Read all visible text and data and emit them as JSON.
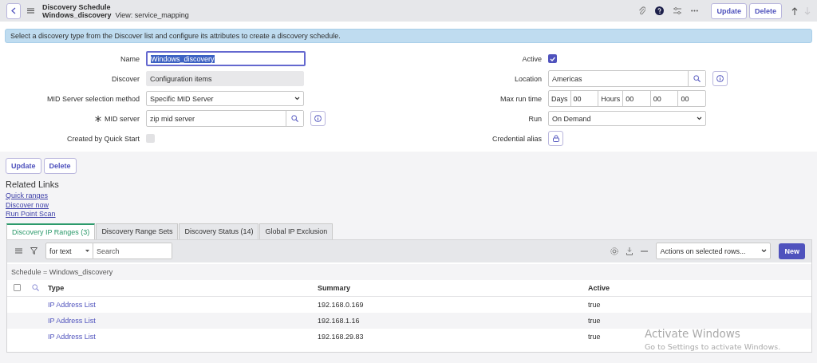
{
  "header": {
    "title": "Discovery Schedule",
    "record": "Windows_discovery",
    "view": "View: service_mapping",
    "buttons": [
      "Update",
      "Delete"
    ],
    "nav": [
      {
        "kind": "up",
        "disabled": false
      },
      {
        "kind": "down",
        "disabled": true
      }
    ]
  },
  "info_message": "Select a discovery type from the Discover list and configure its attributes to create a discovery schedule.",
  "form": {
    "left": [
      {
        "kind": "text",
        "label": "Name",
        "value": "Windows_discovery",
        "focused": true
      },
      {
        "kind": "readonly",
        "label": "Discover",
        "value": "Configuration items"
      },
      {
        "kind": "select",
        "label": "MID Server selection method",
        "value": "Specific MID Server"
      },
      {
        "kind": "reference",
        "label": "MID server",
        "value": "zip mid server",
        "required": true
      },
      {
        "kind": "checkbox",
        "label": "Created by Quick Start",
        "checked": false
      }
    ],
    "right": [
      {
        "kind": "checkbox",
        "label": "Active",
        "checked": true
      },
      {
        "kind": "reference",
        "label": "Location",
        "value": "Americas",
        "required": false
      },
      {
        "kind": "duration",
        "label": "Max run time",
        "parts": [
          {
            "unit": "Days",
            "value": "00"
          },
          {
            "unit": "Hours",
            "value": "00"
          },
          {
            "value": "00"
          },
          {
            "value": "00"
          }
        ]
      },
      {
        "kind": "select",
        "label": "Run",
        "value": "On Demand"
      },
      {
        "kind": "lock",
        "label": "Credential alias"
      }
    ]
  },
  "bottom_buttons": [
    "Update",
    "Delete"
  ],
  "related_links": {
    "title": "Related Links",
    "links": [
      "Quick ranges",
      "Discover now",
      "Run Point Scan"
    ]
  },
  "tabs": [
    {
      "label": "Discovery IP Ranges (3)",
      "selected": true
    },
    {
      "label": "Discovery Range Sets",
      "selected": false
    },
    {
      "label": "Discovery Status (14)",
      "selected": false
    },
    {
      "label": "Global IP Exclusion",
      "selected": false
    }
  ],
  "list": {
    "select_all_checked": false,
    "filter_select": "for text",
    "search_placeholder": "Search",
    "actions_select": "Actions on selected rows...",
    "new_button": "New",
    "breadcrumb": "Schedule = Windows_discovery",
    "columns": [
      "Type",
      "Summary",
      "Active"
    ],
    "rows": [
      {
        "type": "IP Address List",
        "summary": "192.168.0.169",
        "active": "true"
      },
      {
        "type": "IP Address List",
        "summary": "192.168.1.16",
        "active": "true"
      },
      {
        "type": "IP Address List",
        "summary": "192.168.29.83",
        "active": "true"
      }
    ]
  },
  "os_overlay": {
    "title": "Activate Windows",
    "subtitle": "Go to Settings to activate Windows."
  }
}
